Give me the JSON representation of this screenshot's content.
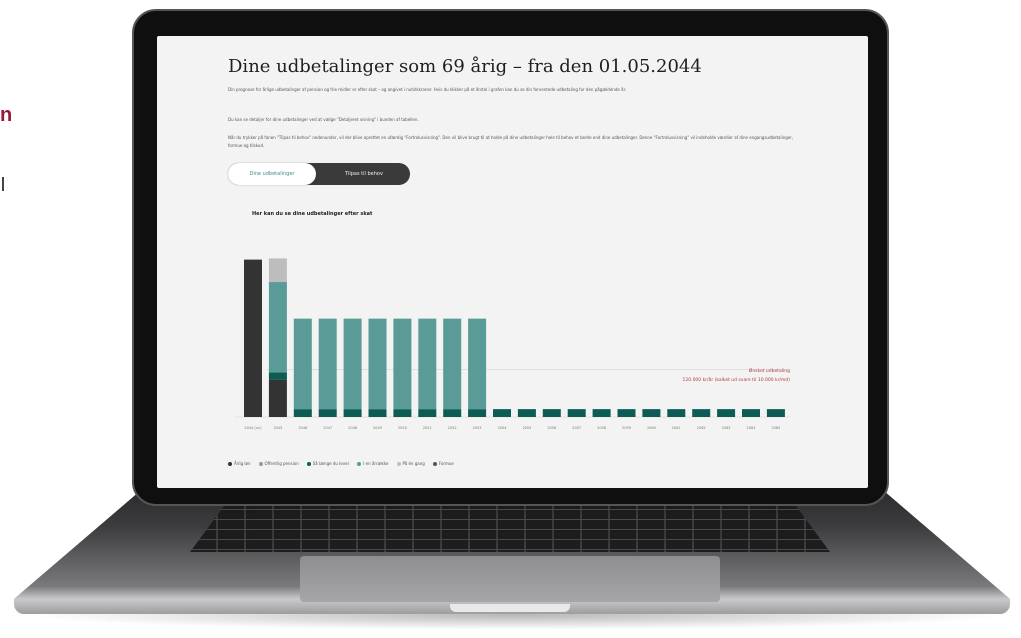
{
  "side": {
    "letter": "n"
  },
  "page": {
    "title": "Dine udbetalinger som 69 årig – fra den 01.05.2044",
    "paragraph_1": "Din prognose for årlige udbetalinger af pension og frie midler er efter skat – og angivet i nutidskroner. Hvis du klikker på et årstal i grafen kan du se din forventede udbetaling for den pågældende år.",
    "paragraph_2": "Du kan se detaljer for dine udbetalinger ved at vælge \"Detaljeret visning\" i bunden af tabellen.",
    "paragraph_3": "Når du trykker på fanen \"Tilpas til behov\" nedenunder, vil der blive oprettet en ufærdig \"Fortrolusvisning\". Den vil blive brugt til at holde på dine udbetalinger hele til behov et bedre end dine udbetalinger. Denne \"Fortrolusvisning\" vil indeholde værdier af dine engangsudbetalinger, formue og tilskud.",
    "toggle": {
      "active": "Dine udbetalinger",
      "inactive": "Tilpas til behov"
    },
    "chart_heading": "Her kan du se dine udbetalinger efter skat"
  },
  "chart_data": {
    "type": "bar",
    "title": "Her kan du se dine udbetalinger efter skat",
    "categories": [
      "2044 (nu)",
      "2045",
      "2046",
      "2047",
      "2048",
      "2049",
      "2050",
      "2051",
      "2052",
      "2053",
      "2054",
      "2055",
      "2056",
      "2057",
      "2058",
      "2059",
      "2060",
      "2061",
      "2062",
      "2063",
      "2064",
      "2065"
    ],
    "series": [
      {
        "name": "Årlig løn",
        "color": "#333333",
        "values": [
          400000,
          95000,
          0,
          0,
          0,
          0,
          0,
          0,
          0,
          0,
          0,
          0,
          0,
          0,
          0,
          0,
          0,
          0,
          0,
          0,
          0,
          0
        ]
      },
      {
        "name": "Offentlig pension",
        "color": "#9a9a9a",
        "values": [
          0,
          0,
          0,
          0,
          0,
          0,
          0,
          0,
          0,
          0,
          0,
          0,
          0,
          0,
          0,
          0,
          0,
          0,
          0,
          0,
          0,
          0
        ]
      },
      {
        "name": "Så længe du lever",
        "color": "#0c5c55",
        "values": [
          0,
          18000,
          20000,
          20000,
          20000,
          20000,
          20000,
          20000,
          20000,
          20000,
          20000,
          20000,
          20000,
          20000,
          20000,
          20000,
          20000,
          20000,
          20000,
          20000,
          20000,
          20000
        ]
      },
      {
        "name": "I en årrække",
        "color": "#5a9b97",
        "values": [
          0,
          230000,
          230000,
          230000,
          230000,
          230000,
          230000,
          230000,
          230000,
          230000,
          0,
          0,
          0,
          0,
          0,
          0,
          0,
          0,
          0,
          0,
          0,
          0
        ]
      },
      {
        "name": "På én gang",
        "color": "#bdbdbd",
        "values": [
          0,
          60000,
          0,
          0,
          0,
          0,
          0,
          0,
          0,
          0,
          0,
          0,
          0,
          0,
          0,
          0,
          0,
          0,
          0,
          0,
          0,
          0
        ]
      },
      {
        "name": "Formue",
        "color": "#555555",
        "values": [
          0,
          0,
          0,
          0,
          0,
          0,
          0,
          0,
          0,
          0,
          0,
          0,
          0,
          0,
          0,
          0,
          0,
          0,
          0,
          0,
          0,
          0
        ]
      }
    ],
    "annotation": {
      "line_1": "Ønsket udbetaling",
      "line_2": "120.000 kr/år (kalket ud svare til 10.000 kr/md)",
      "color": "#b23a3a"
    },
    "ylim": [
      0,
      460000
    ],
    "grid": false,
    "legend_position": "bottom"
  },
  "colors": {
    "brand": "#9b1836",
    "teal": "#5a9b97",
    "dark_teal": "#0c5c55"
  }
}
